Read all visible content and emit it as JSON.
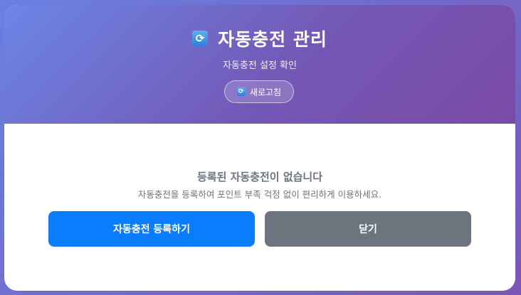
{
  "header": {
    "title_icon": "refresh-icon",
    "title": "자동충전 관리",
    "subtitle": "자동충전 설정 확인",
    "refresh_label": "새로고침"
  },
  "empty_state": {
    "title": "등록된 자동충전이 없습니다",
    "description": "자동충전을 등록하여 포인트 부족 걱정 없이 편리하게 이용하세요."
  },
  "actions": {
    "register_label": "자동충전 등록하기",
    "close_label": "닫기"
  },
  "colors": {
    "primary": "#0a7cff",
    "secondary": "#6c757d",
    "header_start": "#6b86e6",
    "header_end": "#7a4aa6"
  }
}
